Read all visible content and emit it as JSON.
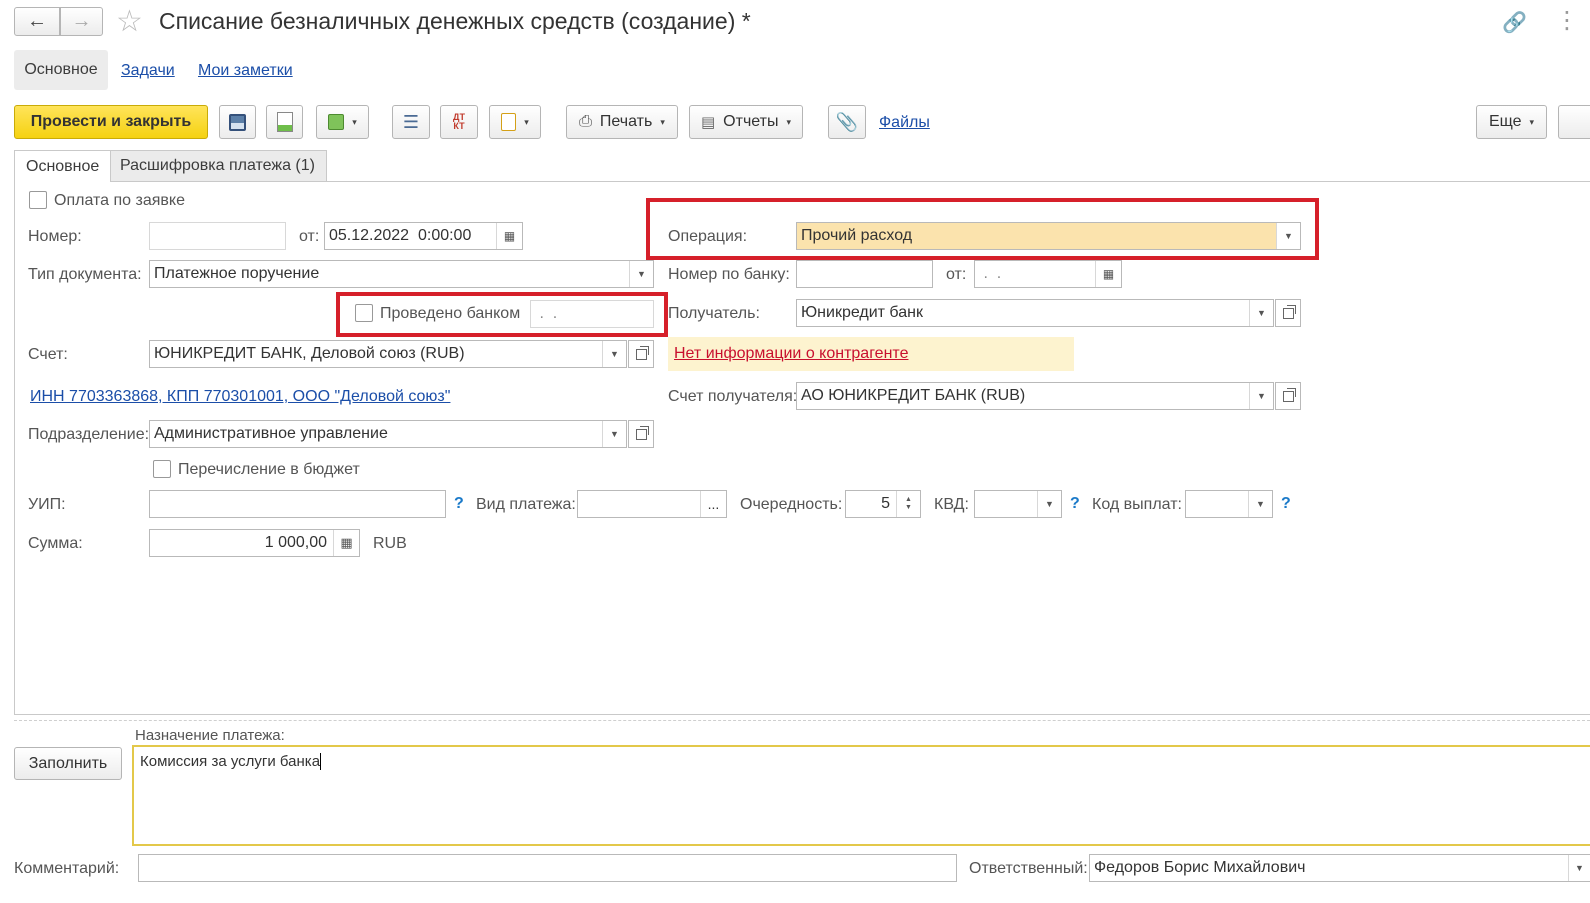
{
  "window": {
    "title": "Списание безналичных денежных средств (создание) *"
  },
  "nav": {
    "tabs": [
      "Основное",
      "Задачи",
      "Мои заметки"
    ]
  },
  "toolbar": {
    "post_close": "Провести и закрыть",
    "print": "Печать",
    "reports": "Отчеты",
    "files": "Файлы",
    "more": "Еще",
    "dt_kt": "ДТ КТ"
  },
  "form_tabs": [
    "Основное",
    "Расшифровка платежа (1)"
  ],
  "left": {
    "pay_by_request": "Оплата по заявке",
    "number_label": "Номер:",
    "number_value": "",
    "from_label": "от:",
    "date_value": "05.12.2022  0:00:00",
    "doctype_label": "Тип документа:",
    "doctype_value": "Платежное поручение",
    "bank_done": "Проведено банком",
    "bank_done_date": " .  .",
    "account_label": "Счет:",
    "account_value": "ЮНИКРЕДИТ БАНК, Деловой союз (RUB)",
    "org_link": "ИНН 7703363868, КПП 770301001, ООО \"Деловой союз\"",
    "dept_label": "Подразделение:",
    "dept_value": "Административное управление",
    "budget": "Перечисление в бюджет",
    "uip_label": "УИП:",
    "sum_label": "Сумма:",
    "sum_value": "1 000,00",
    "currency": "RUB"
  },
  "right": {
    "operation_label": "Операция:",
    "operation_value": "Прочий расход",
    "bank_number_label": "Номер по банку:",
    "from_label": "от:",
    "bank_date": " .  .",
    "recipient_label": "Получатель:",
    "recipient_value": "Юникредит банк",
    "no_info": "Нет информации о контрагенте",
    "recipient_account_label": "Счет получателя:",
    "recipient_account_value": "АО ЮНИКРЕДИТ БАНК (RUB)"
  },
  "payment_row": {
    "kind_label": "Вид платежа:",
    "kind_btn": "...",
    "order_label": "Очередность:",
    "order_value": "5",
    "kvd_label": "КВД:",
    "code_label": "Код выплат:",
    "help": "?"
  },
  "purpose": {
    "label": "Назначение платежа:",
    "fill_btn": "Заполнить",
    "text": "Комиссия за услуги банка"
  },
  "footer": {
    "comment_label": "Комментарий:",
    "responsible_label": "Ответственный:",
    "responsible_value": "Федоров Борис Михайлович"
  },
  "colors": {
    "accent_yellow": "#f5d211",
    "highlight_red": "#d6202a",
    "operation_bg": "#fbe3ad",
    "link_blue": "#1b4ea8",
    "warning_bg": "#fdf3cf",
    "warning_text": "#c8102e"
  }
}
